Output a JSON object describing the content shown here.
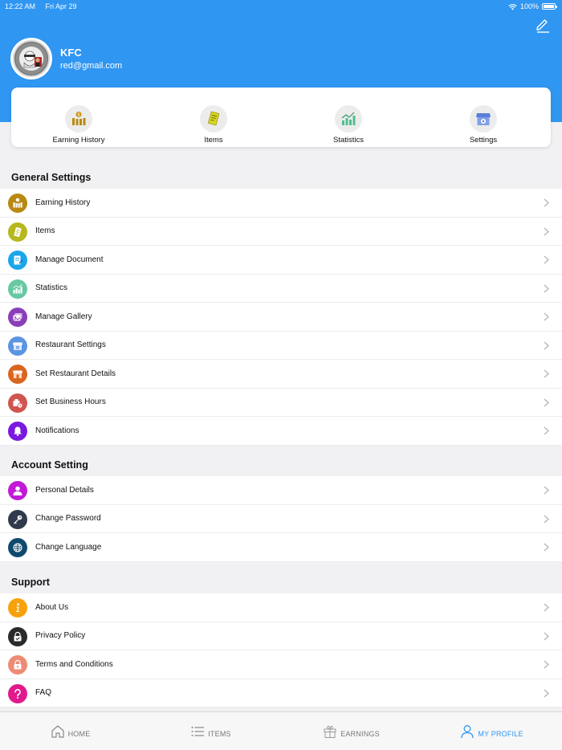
{
  "status_bar": {
    "time": "12:22 AM",
    "date": "Fri Apr 29",
    "battery": "100%"
  },
  "profile": {
    "name": "KFC",
    "email": "red@gmail.com"
  },
  "quick_actions": [
    {
      "label": "Earning History",
      "icon": "earning-history-icon"
    },
    {
      "label": "Items",
      "icon": "items-icon"
    },
    {
      "label": "Statistics",
      "icon": "statistics-icon"
    },
    {
      "label": "Settings",
      "icon": "settings-store-icon"
    }
  ],
  "sections": {
    "general": {
      "title": "General Settings",
      "items": [
        {
          "label": "Earning History",
          "icon": "earning-history-icon",
          "color": "#b88a12"
        },
        {
          "label": "Items",
          "icon": "items-icon",
          "color": "#b7b81c"
        },
        {
          "label": "Manage Document",
          "icon": "document-icon",
          "color": "#1aa6ea"
        },
        {
          "label": "Statistics",
          "icon": "statistics-icon",
          "color": "#67c8a3"
        },
        {
          "label": "Manage Gallery",
          "icon": "gallery-icon",
          "color": "#8a3fb8"
        },
        {
          "label": "Restaurant Settings",
          "icon": "restaurant-settings-icon",
          "color": "#5a95e2"
        },
        {
          "label": "Set Restaurant Details",
          "icon": "restaurant-details-icon",
          "color": "#d9661e"
        },
        {
          "label": "Set Business Hours",
          "icon": "business-hours-icon",
          "color": "#d0554f"
        },
        {
          "label": "Notifications",
          "icon": "bell-icon",
          "color": "#7b18e0"
        }
      ]
    },
    "account": {
      "title": "Account Setting",
      "items": [
        {
          "label": "Personal Details",
          "icon": "person-icon",
          "color": "#c21ad6"
        },
        {
          "label": "Change Password",
          "icon": "key-icon",
          "color": "#313a4d"
        },
        {
          "label": "Change Language",
          "icon": "globe-icon",
          "color": "#0f4a6e"
        }
      ]
    },
    "support": {
      "title": "Support",
      "items": [
        {
          "label": "About Us",
          "icon": "info-icon",
          "color": "#f7a20c"
        },
        {
          "label": "Privacy Policy",
          "icon": "privacy-lock-icon",
          "color": "#2a2a2a"
        },
        {
          "label": "Terms and Conditions",
          "icon": "terms-lock-icon",
          "color": "#ee8b74"
        },
        {
          "label": "FAQ",
          "icon": "question-icon",
          "color": "#e01a8c"
        }
      ]
    }
  },
  "bottom_nav": [
    {
      "label": "HOME",
      "icon": "home-icon"
    },
    {
      "label": "ITEMS",
      "icon": "list-icon"
    },
    {
      "label": "EARNINGS",
      "icon": "gift-icon"
    },
    {
      "label": "MY PROFILE",
      "icon": "user-icon",
      "active": true
    }
  ],
  "colors": {
    "primary": "#2f96f2",
    "background": "#f1f1f3"
  }
}
